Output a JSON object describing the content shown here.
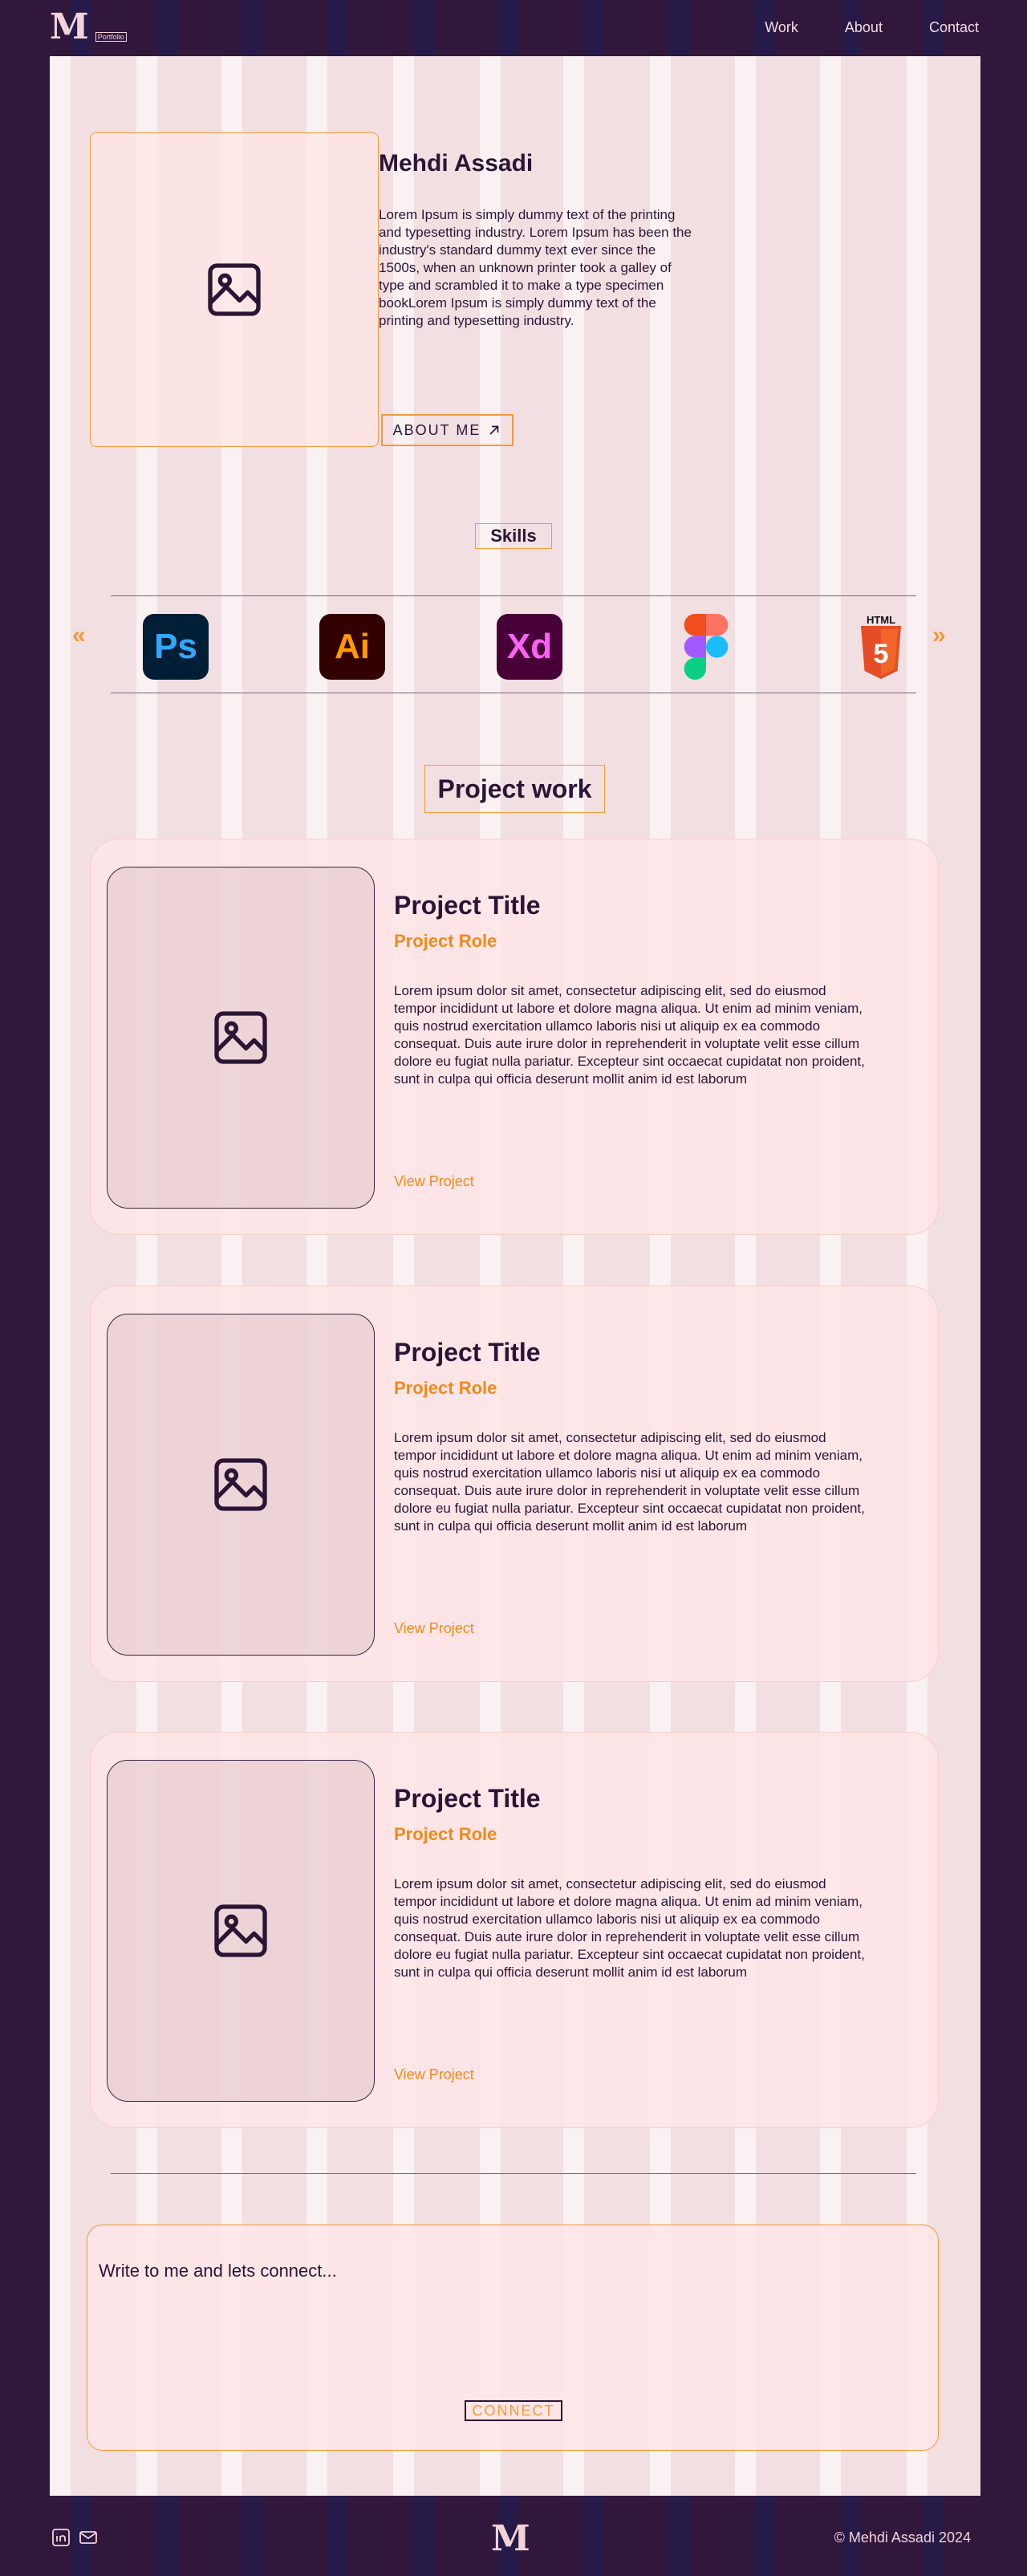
{
  "header": {
    "logo": "M",
    "logo_tag": "Portfolio",
    "nav": [
      "Work",
      "About",
      "Contact"
    ]
  },
  "hero": {
    "name": "Mehdi Assadi",
    "bio": "Lorem Ipsum is simply dummy text of the printing and typesetting industry. Lorem Ipsum has been the industry's standard dummy text ever since the 1500s, when an unknown printer took a galley of type and scrambled it to make a type specimen bookLorem Ipsum is simply dummy text of the printing and typesetting industry.",
    "about_button": "ABOUT ME"
  },
  "skills": {
    "title": "Skills",
    "prev": "«",
    "next": "»",
    "items": [
      {
        "name": "photoshop-icon",
        "label": "Ps",
        "bg": "#001e36",
        "fg": "#31a8ff"
      },
      {
        "name": "illustrator-icon",
        "label": "Ai",
        "bg": "#330000",
        "fg": "#ff9a00"
      },
      {
        "name": "xd-icon",
        "label": "Xd",
        "bg": "#470137",
        "fg": "#ff61f6"
      },
      {
        "name": "figma-icon",
        "label": "",
        "bg": "transparent",
        "fg": ""
      },
      {
        "name": "html5-icon",
        "label": "5",
        "bg": "transparent",
        "fg": "#ffffff",
        "caption": "HTML"
      }
    ]
  },
  "projects": {
    "heading": "Project work",
    "items": [
      {
        "title": "Project Title",
        "role": "Project Role",
        "description": "Lorem ipsum dolor sit amet, consectetur adipiscing elit, sed do eiusmod tempor incididunt ut labore et dolore magna aliqua. Ut enim ad minim veniam, quis nostrud exercitation ullamco laboris nisi ut aliquip ex ea commodo consequat. Duis aute irure dolor in reprehenderit in voluptate velit esse cillum dolore eu fugiat nulla pariatur. Excepteur sint occaecat cupidatat non proident, sunt in culpa qui officia deserunt mollit anim id est laborum",
        "link": "View Project"
      },
      {
        "title": "Project Title",
        "role": "Project Role",
        "description": "Lorem ipsum dolor sit amet, consectetur adipiscing elit, sed do eiusmod tempor incididunt ut labore et dolore magna aliqua. Ut enim ad minim veniam, quis nostrud exercitation ullamco laboris nisi ut aliquip ex ea commodo consequat. Duis aute irure dolor in reprehenderit in voluptate velit esse cillum dolore eu fugiat nulla pariatur. Excepteur sint occaecat cupidatat non proident, sunt in culpa qui officia deserunt mollit anim id est laborum",
        "link": "View Project"
      },
      {
        "title": "Project Title",
        "role": "Project Role",
        "description": "Lorem ipsum dolor sit amet, consectetur adipiscing elit, sed do eiusmod tempor incididunt ut labore et dolore magna aliqua. Ut enim ad minim veniam, quis nostrud exercitation ullamco laboris nisi ut aliquip ex ea commodo consequat. Duis aute irure dolor in reprehenderit in voluptate velit esse cillum dolore eu fugiat nulla pariatur. Excepteur sint occaecat cupidatat non proident, sunt in culpa qui officia deserunt mollit anim id est laborum",
        "link": "View Project"
      }
    ]
  },
  "contact": {
    "placeholder": "Write to me and lets connect...",
    "button": "CONNECT"
  },
  "footer": {
    "logo": "M",
    "copyright": "© Mehdi Assadi 2024",
    "social": [
      "linkedin-icon",
      "mail-icon"
    ]
  },
  "colors": {
    "background": "#32173d",
    "panel": "#f2dfe2",
    "accent": "#f39a3a",
    "text": "#2b1535"
  }
}
